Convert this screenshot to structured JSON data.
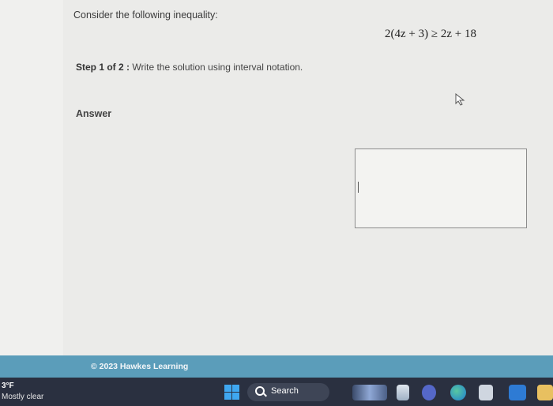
{
  "problem": {
    "prompt": "Consider the following inequality:",
    "equation": "2(4z + 3) ≥ 2z + 18",
    "step_label": "Step 1 of 2 :",
    "step_text": " Write the solution using interval notation.",
    "answer_label": "Answer"
  },
  "answer_input": {
    "value": ""
  },
  "footer": {
    "copyright": "© 2023 Hawkes Learning"
  },
  "taskbar": {
    "weather_temp": "3°F",
    "weather_condition": "Mostly clear",
    "search_label": "Search",
    "icons": [
      "windows-start-icon",
      "search-icon",
      "landscape-widget-icon",
      "file-explorer-icon",
      "chat-icon",
      "edge-browser-icon",
      "store-icon",
      "news-icon"
    ]
  },
  "colors": {
    "footer_bar": "#5b9dba",
    "taskbar": "#2a3040",
    "windows_blue": "#3fa7f0"
  }
}
